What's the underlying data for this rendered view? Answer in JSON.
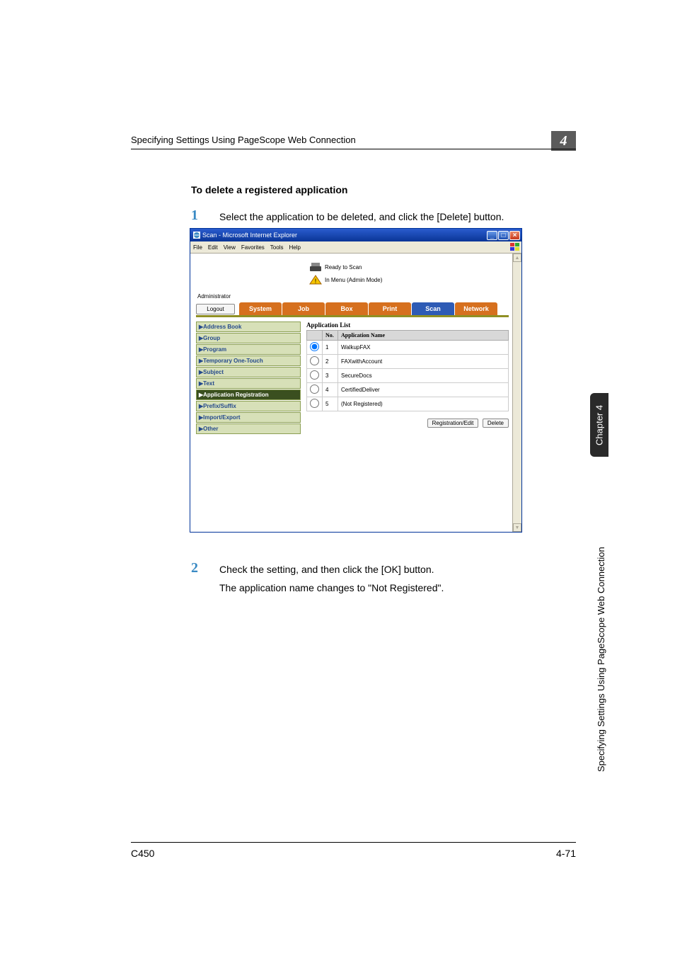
{
  "header": {
    "breadcrumb": "Specifying Settings Using PageScope Web Connection",
    "section_number": "4"
  },
  "subheading": "To delete a registered application",
  "steps": {
    "n1": "1",
    "t1": "Select the application to be deleted, and click the [Delete] button.",
    "n2": "2",
    "t2a": "Check the setting, and then click the [OK] button.",
    "t2b": "The application name changes to \"Not Registered\"."
  },
  "browser": {
    "title": "Scan - Microsoft Internet Explorer",
    "menus": [
      "File",
      "Edit",
      "View",
      "Favorites",
      "Tools",
      "Help"
    ],
    "status1": "Ready to Scan",
    "status2": "In Menu (Admin Mode)",
    "admin_label": "Administrator",
    "logout": "Logout",
    "tabs": [
      "System",
      "Job",
      "Box",
      "Print",
      "Scan",
      "Network"
    ],
    "selected_tab": "Scan"
  },
  "sidebar": {
    "items": [
      "▶Address Book",
      "▶Group",
      "▶Program",
      "▶Temporary One-Touch",
      "▶Subject",
      "▶Text",
      "▶Application Registration",
      "▶Prefix/Suffix",
      "▶Import/Export",
      "▶Other"
    ],
    "selected_index": 6
  },
  "panel": {
    "title": "Application List",
    "headers": {
      "radio": "",
      "no": "No.",
      "name": "Application Name"
    },
    "rows": [
      {
        "no": "1",
        "name": "WalkupFAX",
        "checked": true
      },
      {
        "no": "2",
        "name": "FAXwithAccount",
        "checked": false
      },
      {
        "no": "3",
        "name": "SecureDocs",
        "checked": false
      },
      {
        "no": "4",
        "name": "CertifiedDeliver",
        "checked": false
      },
      {
        "no": "5",
        "name": "(Not Registered)",
        "checked": false
      }
    ],
    "reg_btn": "Registration/Edit",
    "del_btn": "Delete"
  },
  "side": {
    "chapter": "Chapter 4",
    "label": "Specifying Settings Using PageScope Web Connection"
  },
  "footer": {
    "left": "C450",
    "right": "4-71"
  }
}
